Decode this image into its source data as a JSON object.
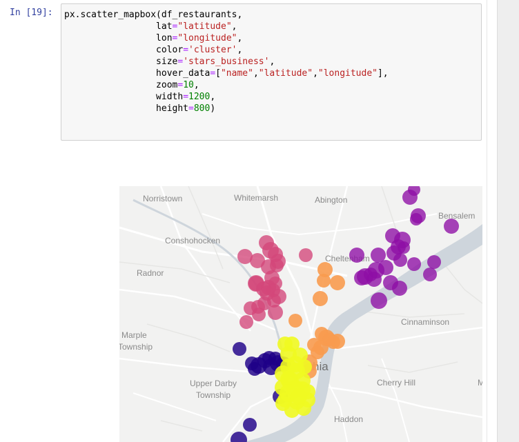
{
  "cell": {
    "prompt": "In [19]:",
    "code_lines": [
      [
        {
          "t": "px.scatter_mapbox(df_restaurants,",
          "c": ""
        }
      ],
      [
        {
          "t": "                 lat",
          "c": ""
        },
        {
          "t": "=",
          "c": "k-op"
        },
        {
          "t": "\"latitude\"",
          "c": "k-str"
        },
        {
          "t": ",",
          "c": ""
        }
      ],
      [
        {
          "t": "                 lon",
          "c": ""
        },
        {
          "t": "=",
          "c": "k-op"
        },
        {
          "t": "\"longitude\"",
          "c": "k-str"
        },
        {
          "t": ",",
          "c": ""
        }
      ],
      [
        {
          "t": "                 color",
          "c": ""
        },
        {
          "t": "=",
          "c": "k-op"
        },
        {
          "t": "'cluster'",
          "c": "k-str"
        },
        {
          "t": ",",
          "c": ""
        }
      ],
      [
        {
          "t": "                 size",
          "c": ""
        },
        {
          "t": "=",
          "c": "k-op"
        },
        {
          "t": "'stars_business'",
          "c": "k-str"
        },
        {
          "t": ",",
          "c": ""
        }
      ],
      [
        {
          "t": "                 hover_data",
          "c": ""
        },
        {
          "t": "=",
          "c": "k-op"
        },
        {
          "t": "[",
          "c": ""
        },
        {
          "t": "\"name\"",
          "c": "k-str"
        },
        {
          "t": ",",
          "c": ""
        },
        {
          "t": "\"latitude\"",
          "c": "k-str"
        },
        {
          "t": ",",
          "c": ""
        },
        {
          "t": "\"longitude\"",
          "c": "k-str"
        },
        {
          "t": "],",
          "c": ""
        }
      ],
      [
        {
          "t": "                 zoom",
          "c": ""
        },
        {
          "t": "=",
          "c": "k-op"
        },
        {
          "t": "10",
          "c": "k-num"
        },
        {
          "t": ",",
          "c": ""
        }
      ],
      [
        {
          "t": "                 width",
          "c": ""
        },
        {
          "t": "=",
          "c": "k-op"
        },
        {
          "t": "1200",
          "c": "k-num"
        },
        {
          "t": ",",
          "c": ""
        }
      ],
      [
        {
          "t": "                 height",
          "c": ""
        },
        {
          "t": "=",
          "c": "k-op"
        },
        {
          "t": "800",
          "c": "k-num"
        },
        {
          "t": ")",
          "c": ""
        }
      ]
    ]
  },
  "map": {
    "labels": {
      "norristown": "Norristown",
      "whitemarsh": "Whitemarsh",
      "abington": "Abington",
      "bensalem": "Bensalem",
      "conshohocken": "Conshohocken",
      "radnor": "Radnor",
      "cheltenham": "Cheltenham",
      "cinnaminson": "Cinnaminson",
      "marple": "Marple",
      "marple_township": "Township",
      "philadelphia_fragment": "hia",
      "upper_darby": "Upper Darby",
      "upper_darby_township": "Township",
      "cherry_hill": "Cherry Hill",
      "haddon": "Haddon",
      "edge_m": "M"
    },
    "colors": {
      "purple": "#8e0ea5",
      "magenta": "#d3467a",
      "orange": "#f89b4f",
      "yellow": "#f0f921",
      "navy": "#1e0087",
      "water": "#ced5dc"
    }
  }
}
